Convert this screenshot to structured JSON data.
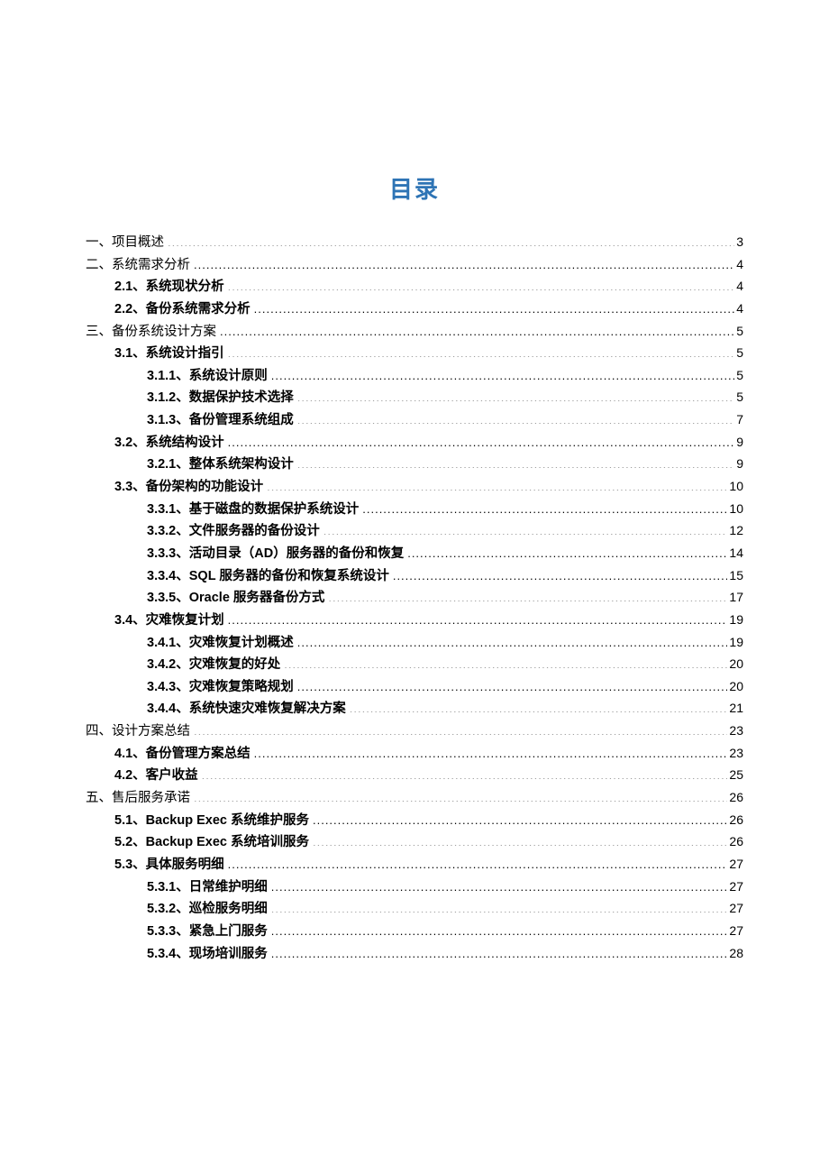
{
  "title": "目录",
  "toc": [
    {
      "level": 0,
      "bold": false,
      "num": "",
      "label": "一、项目概述",
      "page": "3"
    },
    {
      "level": 0,
      "bold": false,
      "num": "",
      "label": "二、系统需求分析",
      "page": "4"
    },
    {
      "level": 1,
      "bold": true,
      "num": "2.1、",
      "label": "系统现状分析",
      "page": "4"
    },
    {
      "level": 1,
      "bold": true,
      "num": "2.2、",
      "label": "备份系统需求分析",
      "page": "4"
    },
    {
      "level": 0,
      "bold": false,
      "num": "",
      "label": "三、备份系统设计方案",
      "page": "5"
    },
    {
      "level": 1,
      "bold": true,
      "num": "3.1、",
      "label": "系统设计指引",
      "page": "5"
    },
    {
      "level": 2,
      "bold": true,
      "num": "3.1.1、",
      "label": "系统设计原则",
      "page": "5"
    },
    {
      "level": 2,
      "bold": true,
      "num": "3.1.2、",
      "label": "数据保护技术选择",
      "page": "5"
    },
    {
      "level": 2,
      "bold": true,
      "num": "3.1.3、",
      "label": "备份管理系统组成",
      "page": "7"
    },
    {
      "level": 1,
      "bold": true,
      "num": "3.2、",
      "label": "系统结构设计",
      "page": "9"
    },
    {
      "level": 2,
      "bold": true,
      "num": "3.2.1、",
      "label": "整体系统架构设计",
      "page": "9"
    },
    {
      "level": 1,
      "bold": true,
      "num": "3.3、",
      "label": "备份架构的功能设计",
      "page": "10"
    },
    {
      "level": 2,
      "bold": true,
      "num": "3.3.1、",
      "label": "基于磁盘的数据保护系统设计",
      "page": "10"
    },
    {
      "level": 2,
      "bold": true,
      "num": "3.3.2、",
      "label": "文件服务器的备份设计",
      "page": "12"
    },
    {
      "level": 2,
      "bold": true,
      "num": "3.3.3、",
      "label": "活动目录（AD）服务器的备份和恢复",
      "page": "14"
    },
    {
      "level": 2,
      "bold": true,
      "num": "3.3.4、",
      "label": "SQL 服务器的备份和恢复系统设计",
      "page": "15"
    },
    {
      "level": 2,
      "bold": true,
      "num": "3.3.5、",
      "label": "Oracle 服务器备份方式",
      "page": "17"
    },
    {
      "level": 1,
      "bold": true,
      "num": "3.4、",
      "label": "灾难恢复计划",
      "page": "19"
    },
    {
      "level": 2,
      "bold": true,
      "num": "3.4.1、",
      "label": "灾难恢复计划概述",
      "page": "19"
    },
    {
      "level": 2,
      "bold": true,
      "num": "3.4.2、",
      "label": "灾难恢复的好处",
      "page": "20"
    },
    {
      "level": 2,
      "bold": true,
      "num": "3.4.3、",
      "label": "灾难恢复策略规划",
      "page": "20"
    },
    {
      "level": 2,
      "bold": true,
      "num": "3.4.4、",
      "label": "系统快速灾难恢复解决方案",
      "page": "21"
    },
    {
      "level": 0,
      "bold": false,
      "num": "",
      "label": "四、设计方案总结",
      "page": "23"
    },
    {
      "level": 1,
      "bold": true,
      "num": "4.1、",
      "label": "备份管理方案总结",
      "page": "23"
    },
    {
      "level": 1,
      "bold": true,
      "num": "4.2、",
      "label": "客户收益",
      "page": "25"
    },
    {
      "level": 0,
      "bold": false,
      "num": "",
      "label": "五、售后服务承诺",
      "page": "26"
    },
    {
      "level": 1,
      "bold": true,
      "num": "5.1、",
      "label": "Backup Exec 系统维护服务",
      "page": "26"
    },
    {
      "level": 1,
      "bold": true,
      "num": "5.2、",
      "label": "Backup Exec 系统培训服务",
      "page": "26"
    },
    {
      "level": 1,
      "bold": true,
      "num": "5.3、",
      "label": "具体服务明细",
      "page": "27"
    },
    {
      "level": 2,
      "bold": true,
      "num": "5.3.1、",
      "label": "日常维护明细",
      "page": "27"
    },
    {
      "level": 2,
      "bold": true,
      "num": "5.3.2、",
      "label": "巡检服务明细",
      "page": "27"
    },
    {
      "level": 2,
      "bold": true,
      "num": "5.3.3、",
      "label": "紧急上门服务",
      "page": "27"
    },
    {
      "level": 2,
      "bold": true,
      "num": "5.3.4、",
      "label": "现场培训服务",
      "page": "28"
    }
  ]
}
